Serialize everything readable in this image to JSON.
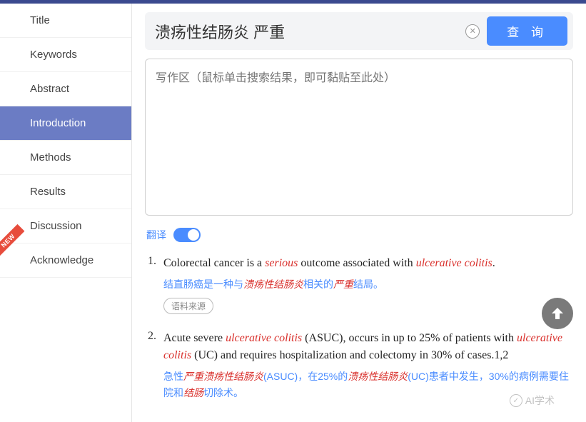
{
  "sidebar": {
    "items": [
      {
        "label": "Title"
      },
      {
        "label": "Keywords"
      },
      {
        "label": "Abstract"
      },
      {
        "label": "Introduction"
      },
      {
        "label": "Methods"
      },
      {
        "label": "Results"
      },
      {
        "label": "Discussion"
      },
      {
        "label": "Acknowledge"
      }
    ],
    "active_index": 3,
    "new_badge_text": "NEW"
  },
  "search": {
    "value": "溃疡性结肠炎 严重",
    "query_button": "查 询"
  },
  "writing_area": {
    "placeholder": "写作区（鼠标单击搜索结果，即可黏贴至此处）"
  },
  "translate": {
    "label": "翻译",
    "enabled": true
  },
  "results": [
    {
      "num": "1.",
      "en_parts": [
        {
          "t": "Colorectal cancer is a ",
          "hl": false
        },
        {
          "t": "serious",
          "hl": true
        },
        {
          "t": " outcome associated with ",
          "hl": false
        },
        {
          "t": "ulcerative colitis",
          "hl": true
        },
        {
          "t": ".",
          "hl": false
        }
      ],
      "zh_parts": [
        {
          "t": "结直肠癌是一种与",
          "hl": false
        },
        {
          "t": "溃疡性结肠炎",
          "hl": true
        },
        {
          "t": "相关的",
          "hl": false
        },
        {
          "t": "严重",
          "hl": true
        },
        {
          "t": "结局。",
          "hl": false
        }
      ],
      "source_label": "语料来源"
    },
    {
      "num": "2.",
      "en_parts": [
        {
          "t": "Acute severe ",
          "hl": false
        },
        {
          "t": "ulcerative colitis",
          "hl": true
        },
        {
          "t": " (ASUC), occurs in up to 25% of patients with ",
          "hl": false
        },
        {
          "t": "ulcerative colitis",
          "hl": true
        },
        {
          "t": " (UC) and requires hospitalization and colectomy in 30% of cases.1,2",
          "hl": false
        }
      ],
      "zh_parts": [
        {
          "t": "急性",
          "hl": false
        },
        {
          "t": "严重溃疡性结肠炎",
          "hl": true
        },
        {
          "t": "(ASUC)，在25%的",
          "hl": false
        },
        {
          "t": "溃疡性结肠炎",
          "hl": true
        },
        {
          "t": "(UC)患者中发生，30%的病例需要住院和",
          "hl": false
        },
        {
          "t": "结肠",
          "hl": true
        },
        {
          "t": "切除术。",
          "hl": false
        }
      ]
    }
  ],
  "watermark": "AI学术"
}
